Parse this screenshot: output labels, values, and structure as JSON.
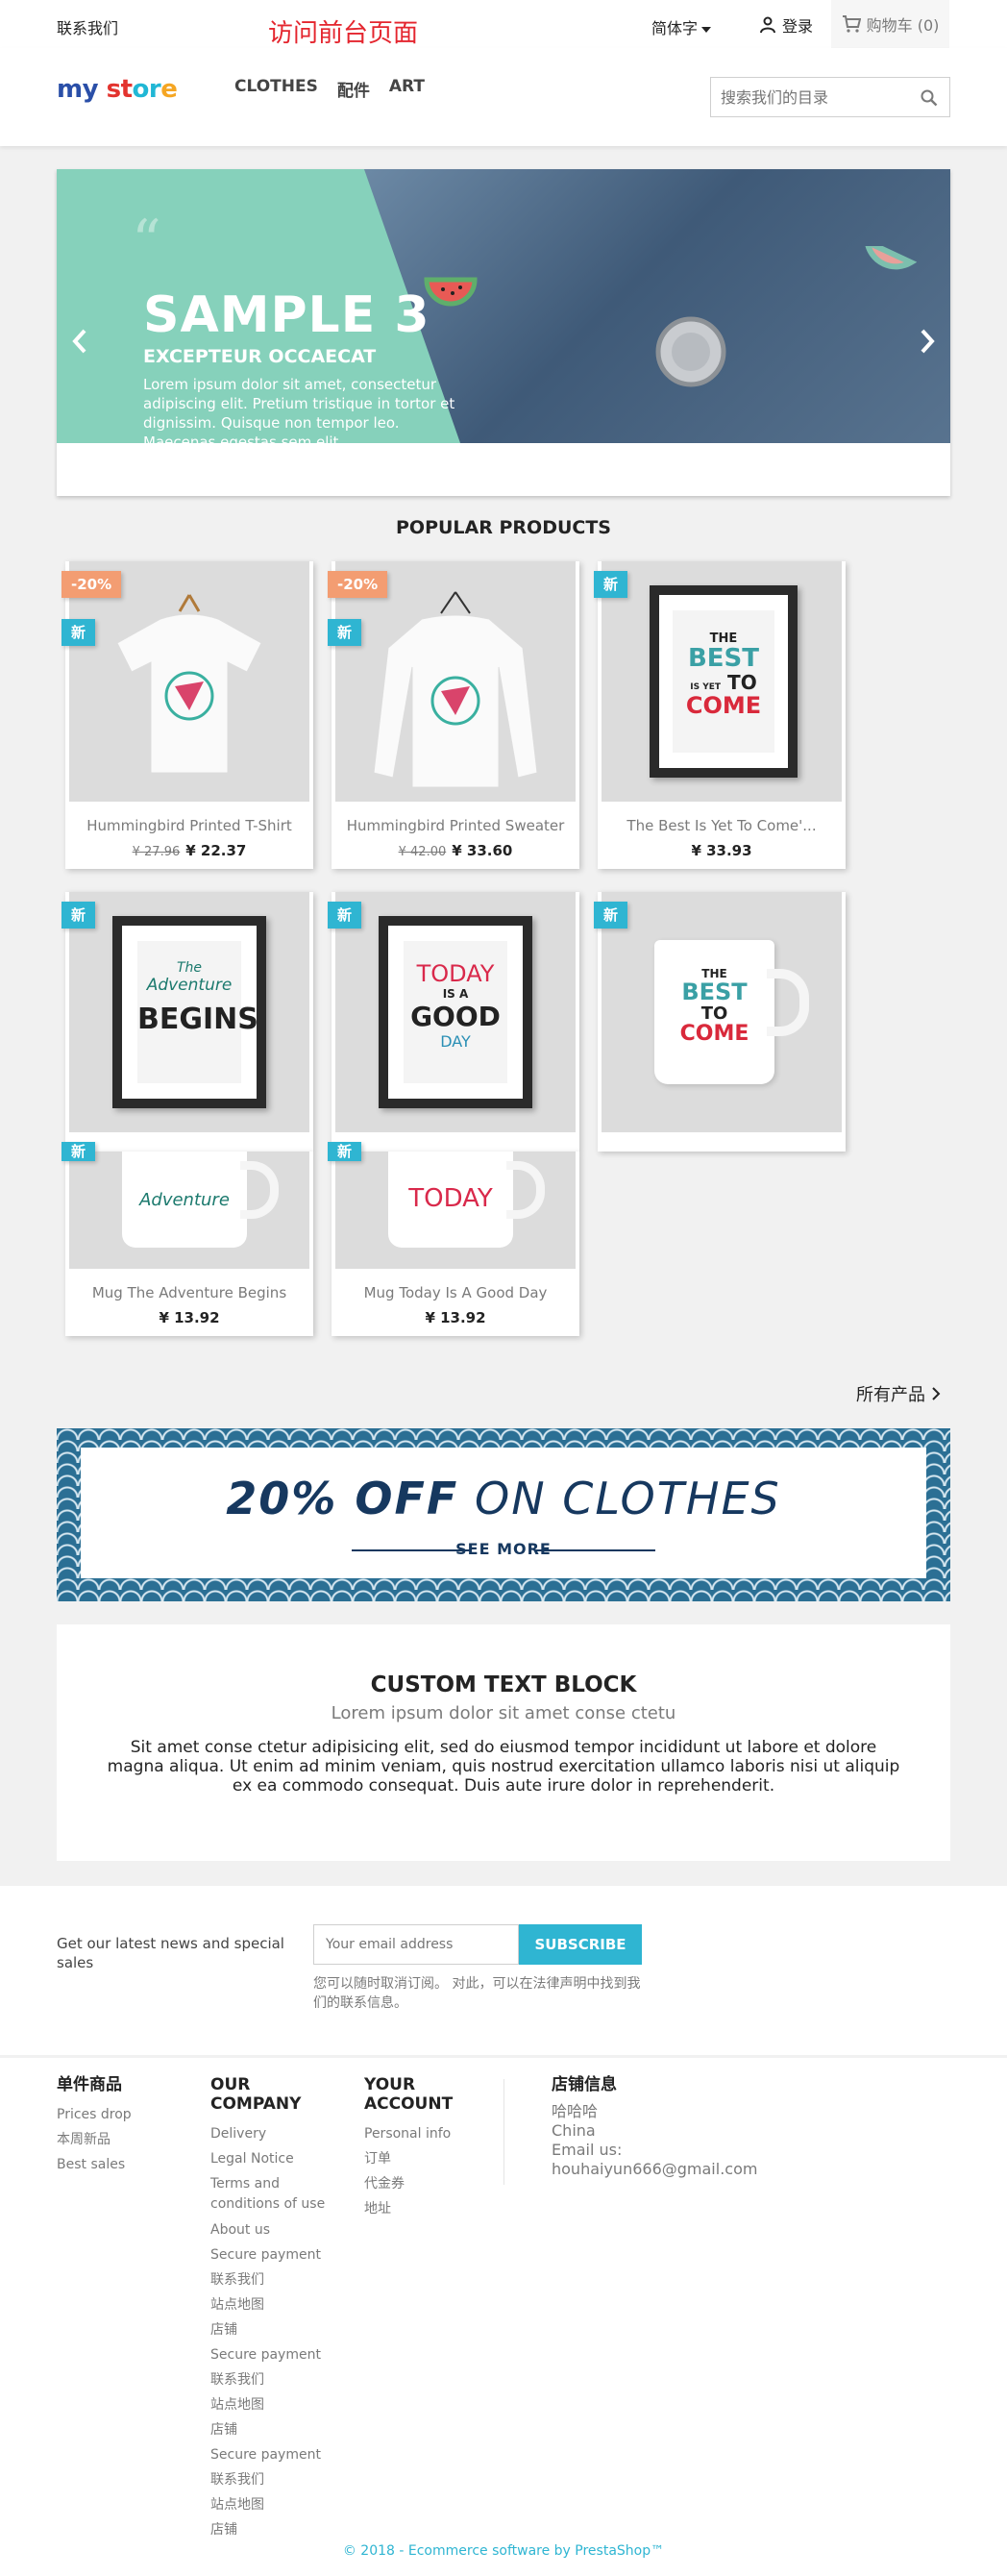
{
  "topnav": {
    "contact": "联系我们",
    "overlay_title": "访问前台页面",
    "language": "简体字",
    "login": "登录",
    "cart": "购物车 (0)"
  },
  "header": {
    "logo": {
      "my": "my",
      "st": "st",
      "or": "or",
      "e": "e"
    },
    "menu": [
      "CLOTHES",
      "配件",
      "ART"
    ],
    "search_placeholder": "搜索我们的目录"
  },
  "slider": {
    "title": "SAMPLE 3",
    "subtitle": "EXCEPTEUR OCCAECAT",
    "text": "Lorem ipsum dolor sit amet, consectetur adipiscing elit. Pretium tristique in tortor et dignissim. Quisque non tempor leo. Maecenas egestas sem elit",
    "teal_color": "#86d1bb"
  },
  "popular": {
    "title": "POPULAR PRODUCTS",
    "products": [
      {
        "name": "Hummingbird Printed T-Shirt",
        "old_price": "¥ 27.96",
        "price": "¥ 22.37",
        "discount": "-20%",
        "new": "新",
        "icon": "tshirt-icon"
      },
      {
        "name": "Hummingbird Printed Sweater",
        "old_price": "¥ 42.00",
        "price": "¥ 33.60",
        "discount": "-20%",
        "new": "新",
        "icon": "sweater-icon"
      },
      {
        "name": "The Best Is Yet To Come'...",
        "old_price": "",
        "price": "¥ 33.93",
        "discount": "",
        "new": "新",
        "icon": "framed-poster-icon"
      },
      {
        "name": "",
        "old_price": "",
        "price": "",
        "discount": "",
        "new": "新",
        "icon": "framed-poster-icon"
      },
      {
        "name": "",
        "old_price": "",
        "price": "",
        "discount": "",
        "new": "新",
        "icon": "framed-poster-icon"
      },
      {
        "name": "",
        "old_price": "",
        "price": "",
        "discount": "",
        "new": "新",
        "icon": "mug-icon"
      },
      {
        "name": "Mug The Adventure Begins",
        "old_price": "",
        "price": "¥ 13.92",
        "discount": "",
        "new": "新",
        "icon": "mug-icon"
      },
      {
        "name": "Mug Today Is A Good Day",
        "old_price": "",
        "price": "¥ 13.92",
        "discount": "",
        "new": "新",
        "icon": "mug-icon"
      }
    ],
    "posters": {
      "best1": "THE",
      "best2": "BEST",
      "best3": "IS YET",
      "best4": "TO",
      "best5": "COME",
      "adv1": "The",
      "adv2": "Adventure",
      "adv3": "BEGINS",
      "today1": "TODAY",
      "today2": "IS A",
      "today3": "GOOD",
      "today4": "DAY"
    },
    "all_products": "所有产品"
  },
  "banner": {
    "bold": "20% OFF",
    "rest": " ON CLOTHES",
    "see_more": "SEE MORE",
    "color": "#16385f"
  },
  "custom_block": {
    "title": "CUSTOM TEXT BLOCK",
    "subtitle": "Lorem ipsum dolor sit amet conse ctetu",
    "text": "Sit amet conse ctetur adipisicing elit, sed do eiusmod tempor incididunt ut labore et dolore magna aliqua. Ut enim ad minim veniam, quis nostrud exercitation ullamco laboris nisi ut aliquip ex ea commodo consequat. Duis aute irure dolor in reprehenderit."
  },
  "newsletter": {
    "label": "Get our latest news and special sales",
    "placeholder": "Your email address",
    "button": "SUBSCRIBE",
    "note": "您可以随时取消订阅。 对此，可以在法律声明中找到我们的联系信息。"
  },
  "footer": {
    "products": {
      "title": "单件商品",
      "links": [
        "Prices drop",
        "本周新品",
        "Best sales"
      ]
    },
    "company": {
      "title": "OUR COMPANY",
      "links": [
        "Delivery",
        "Legal Notice",
        "Terms and conditions of use",
        "About us",
        "Secure payment",
        "联系我们",
        "站点地图",
        "店铺",
        "Secure payment",
        "联系我们",
        "站点地图",
        "店铺",
        "Secure payment",
        "联系我们",
        "站点地图",
        "店铺"
      ]
    },
    "account": {
      "title": "YOUR ACCOUNT",
      "links": [
        "Personal info",
        "订单",
        "代金券",
        "地址"
      ]
    },
    "store": {
      "title": "店铺信息",
      "lines": [
        "哈哈哈",
        "China",
        "Email us:",
        "houhaiyun666@gmail.com"
      ]
    },
    "copyright": "© 2018 - Ecommerce software by PrestaShop™"
  },
  "colors": {
    "accent": "#2fb5d2",
    "discount": "#f39d72",
    "red_title": "#e4252e"
  }
}
